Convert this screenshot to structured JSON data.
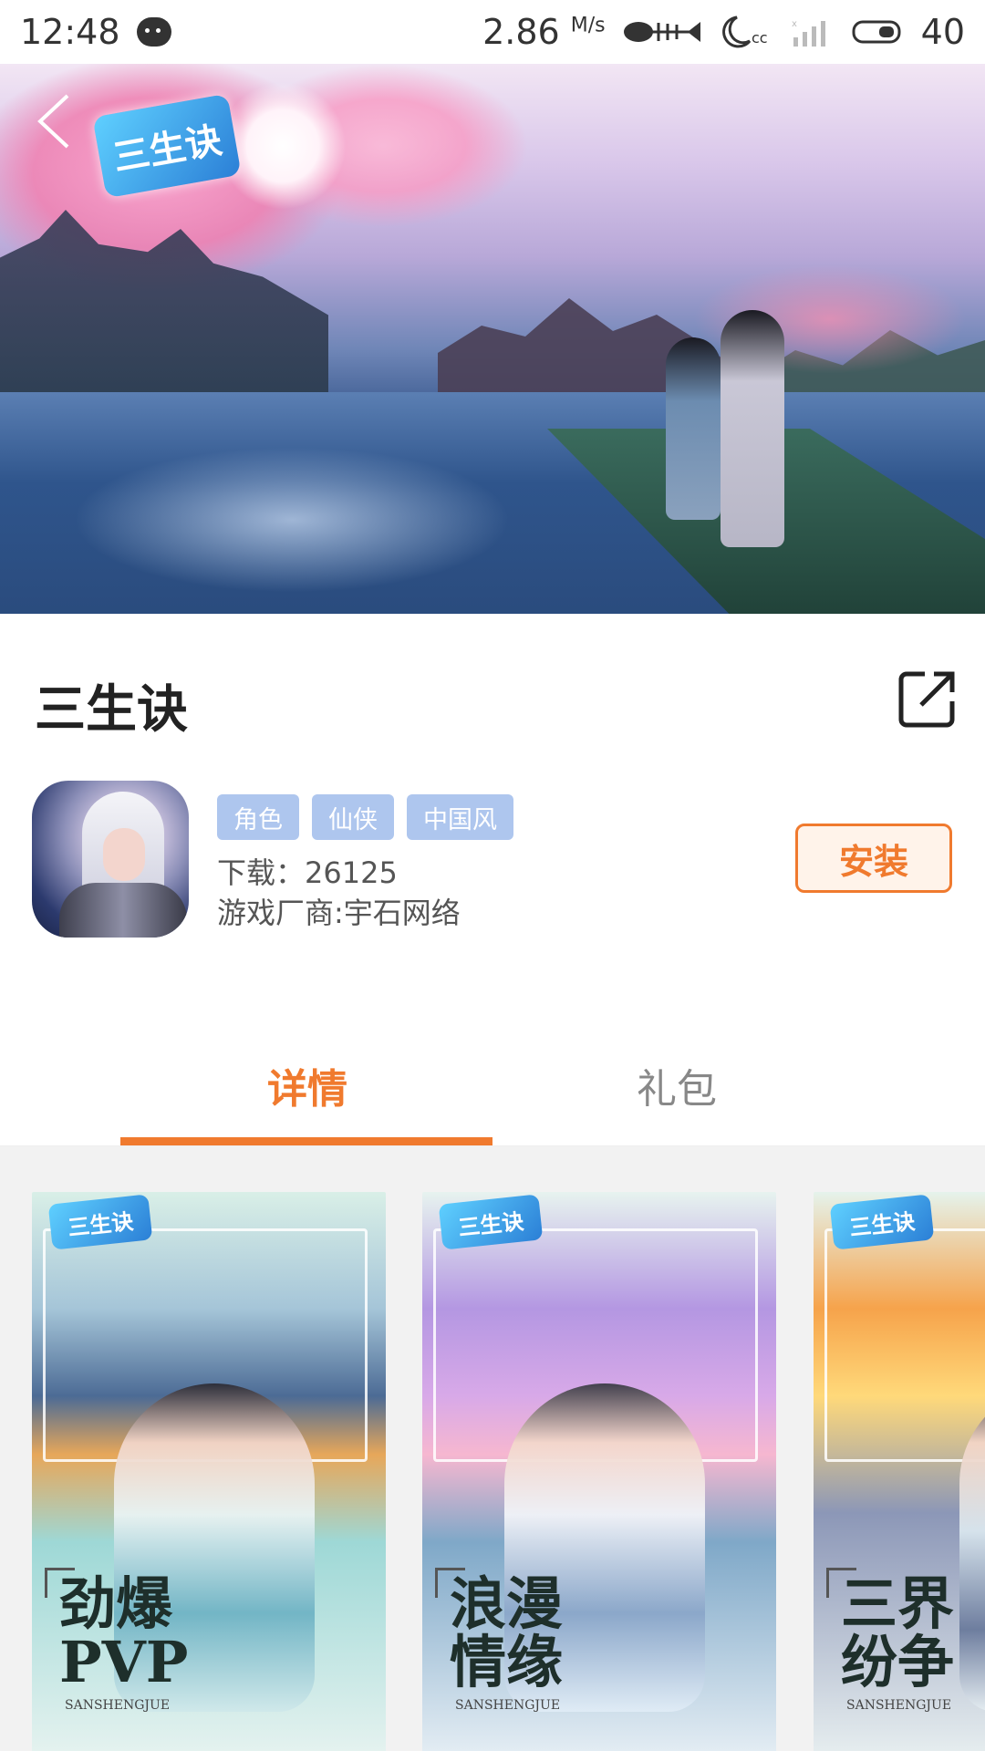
{
  "status_bar": {
    "time": "12:48",
    "net_speed": "2.86",
    "net_unit": "M/s",
    "battery": "40"
  },
  "banner": {
    "logo_text": "三生诀"
  },
  "app": {
    "title": "三生诀",
    "tags": [
      "角色",
      "仙侠",
      "中国风"
    ],
    "downloads": "下载：26125",
    "vendor": "游戏厂商:宇石网络",
    "install_label": "安装"
  },
  "tabs": [
    {
      "label": "详情",
      "active": true
    },
    {
      "label": "礼包",
      "active": false
    }
  ],
  "screenshots": [
    {
      "logo": "三生诀",
      "slogan_line1": "劲爆",
      "slogan_line2": "PVP",
      "sub": "SANSHENGJUE"
    },
    {
      "logo": "三生诀",
      "slogan_line1": "浪漫",
      "slogan_line2": "情缘",
      "sub": "SANSHENGJUE"
    },
    {
      "logo": "三生诀",
      "slogan_line1": "三界",
      "slogan_line2": "纷争",
      "sub": "SANSHENGJUE"
    }
  ],
  "colors": {
    "accent": "#f07a2e",
    "tag_bg": "#aec6ee",
    "background_gray": "#f2f2f2"
  },
  "icons": [
    "chat-icon",
    "fish-icon",
    "moon-icon",
    "signal-icon",
    "battery-icon",
    "back-arrow-icon",
    "share-icon"
  ]
}
